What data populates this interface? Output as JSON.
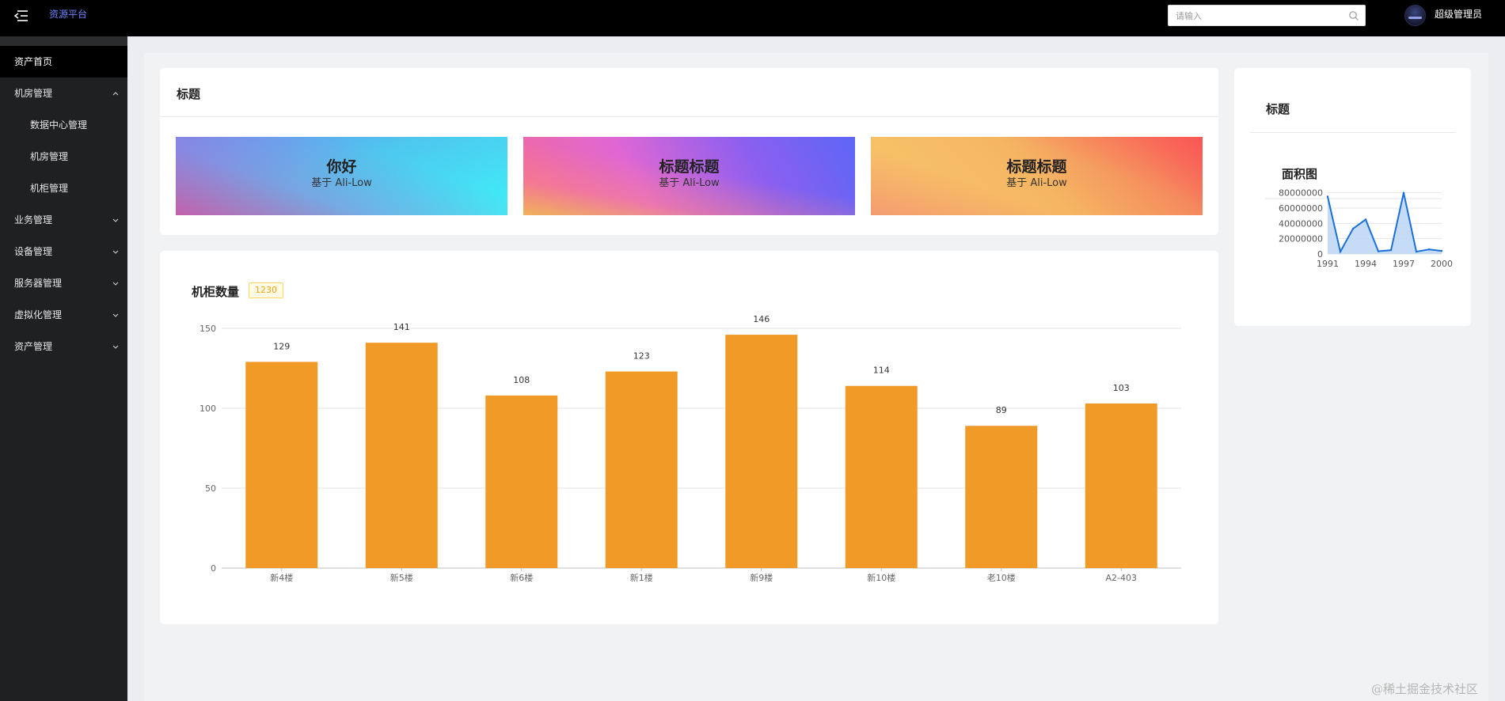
{
  "topbar": {
    "brand": "资源平台",
    "search_placeholder": "请输入",
    "search_value": "",
    "username": "超级管理员"
  },
  "sidebar": {
    "items": [
      {
        "label": "资产首页",
        "active": true,
        "level": 1,
        "chevron": "none"
      },
      {
        "label": "机房管理",
        "active": false,
        "level": 1,
        "chevron": "up"
      },
      {
        "label": "数据中心管理",
        "active": false,
        "level": 2,
        "chevron": "none"
      },
      {
        "label": "机房管理",
        "active": false,
        "level": 2,
        "chevron": "none"
      },
      {
        "label": "机柜管理",
        "active": false,
        "level": 2,
        "chevron": "none"
      },
      {
        "label": "业务管理",
        "active": false,
        "level": 1,
        "chevron": "down"
      },
      {
        "label": "设备管理",
        "active": false,
        "level": 1,
        "chevron": "down"
      },
      {
        "label": "服务器管理",
        "active": false,
        "level": 1,
        "chevron": "down"
      },
      {
        "label": "虚拟化管理",
        "active": false,
        "level": 1,
        "chevron": "down"
      },
      {
        "label": "资产管理",
        "active": false,
        "level": 1,
        "chevron": "down"
      }
    ]
  },
  "banner_card": {
    "title": "标题",
    "tiles": [
      {
        "title": "你好",
        "subtitle": "基于 Ali-Low"
      },
      {
        "title": "标题标题",
        "subtitle": "基于 Ali-Low"
      },
      {
        "title": "标题标题",
        "subtitle": "基于 Ali-Low"
      }
    ]
  },
  "cabinet_card": {
    "title": "机柜数量",
    "badge": "1230"
  },
  "side_card": {
    "title": "标题",
    "chart_title": "面积图"
  },
  "watermark": "@稀土掘金技术社区",
  "colors": {
    "bar": "#f09a28",
    "area_line": "#1a6fd8",
    "area_fill": "#bcd6f5",
    "brand": "#6f86ff",
    "badge": "#f2a30f"
  },
  "chart_data": [
    {
      "type": "bar",
      "categories": [
        "新4楼",
        "新5楼",
        "新6楼",
        "新1楼",
        "新9楼",
        "新10楼",
        "老10楼",
        "A2-403"
      ],
      "values": [
        129,
        141,
        108,
        123,
        146,
        114,
        89,
        103
      ],
      "title": "",
      "xlabel": "",
      "ylabel": "",
      "ylim": [
        0,
        150
      ],
      "yticks": [
        "0",
        "50",
        "100",
        "150"
      ],
      "grid": true,
      "data_labels": true
    },
    {
      "type": "area",
      "x": [
        1991,
        1992,
        1993,
        1994,
        1995,
        1996,
        1997,
        1998,
        1999,
        2000
      ],
      "values": [
        75000000,
        3000000,
        33000000,
        45000000,
        3500000,
        5000000,
        80000000,
        3000000,
        6000000,
        4000000
      ],
      "xticks": [
        "1991",
        "1994",
        "1997",
        "2000"
      ],
      "yticks": [
        "0",
        "20000000",
        "40000000",
        "60000000",
        "80000000"
      ],
      "ylim": [
        0,
        90000000
      ],
      "title": "",
      "grid": true
    }
  ]
}
